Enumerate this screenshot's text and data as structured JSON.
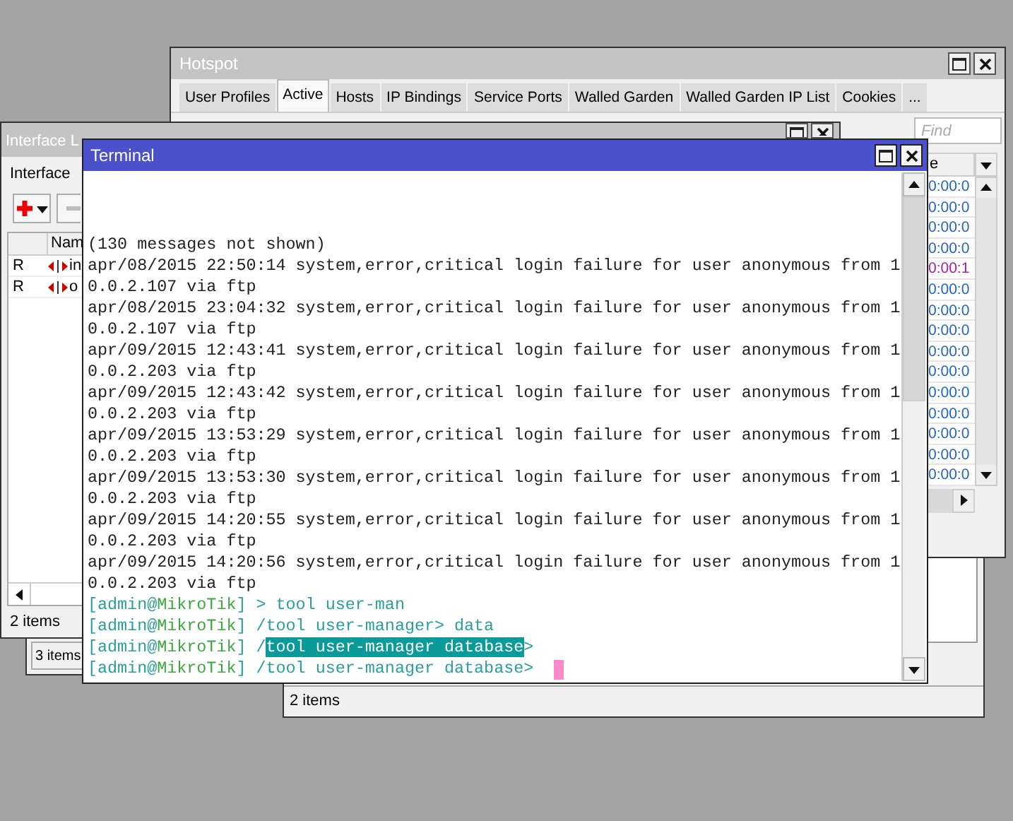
{
  "hotspot": {
    "title": "Hotspot",
    "tabs": [
      {
        "label": "User Profiles",
        "selected": false
      },
      {
        "label": "Active",
        "selected": true
      },
      {
        "label": "Hosts",
        "selected": false
      },
      {
        "label": "IP Bindings",
        "selected": false
      },
      {
        "label": "Service Ports",
        "selected": false
      },
      {
        "label": "Walled Garden",
        "selected": false
      },
      {
        "label": "Walled Garden IP List",
        "selected": false
      },
      {
        "label": "Cookies",
        "selected": false
      },
      {
        "label": "...",
        "selected": false
      }
    ],
    "search": {
      "placeholder": "Find"
    },
    "column": "e",
    "rows": [
      {
        "text": "0:00:0",
        "color": "#1f66c4"
      },
      {
        "text": "0:00:0",
        "color": "#1f66c4"
      },
      {
        "text": "0:00:0",
        "color": "#1f66c4"
      },
      {
        "text": "0:00:0",
        "color": "#1f66c4"
      },
      {
        "text": "0:00:1",
        "color": "#a01fa8"
      },
      {
        "text": "0:00:0",
        "color": "#1f66c4"
      },
      {
        "text": "0:00:0",
        "color": "#1f66c4"
      },
      {
        "text": "0:00:0",
        "color": "#1f66c4"
      },
      {
        "text": "0:00:0",
        "color": "#1f66c4"
      },
      {
        "text": "0:00:0",
        "color": "#1f66c4"
      },
      {
        "text": "0:00:0",
        "color": "#1f66c4"
      },
      {
        "text": "0:00:0",
        "color": "#1f66c4"
      },
      {
        "text": "0:00:0",
        "color": "#1f66c4"
      },
      {
        "text": "0:00:0",
        "color": "#1f66c4"
      },
      {
        "text": "0:00:0",
        "color": "#1f66c4"
      }
    ]
  },
  "back_window": {
    "status": "2 items"
  },
  "small_window": {
    "status": "3 items"
  },
  "interface_list": {
    "title": "Interface L",
    "tab": "Interface",
    "column": "Nam",
    "rows": [
      {
        "flag": "R",
        "name": "in"
      },
      {
        "flag": "R",
        "name": "o"
      }
    ],
    "status": "2 items"
  },
  "terminal": {
    "title": "Terminal",
    "lines": [
      {
        "kind": "output",
        "text": "(130 messages not shown)"
      },
      {
        "kind": "output",
        "text": "apr/08/2015 22:50:14 system,error,critical login failure for user anonymous from 1"
      },
      {
        "kind": "output",
        "text": "0.0.2.107 via ftp"
      },
      {
        "kind": "output",
        "text": "apr/08/2015 23:04:32 system,error,critical login failure for user anonymous from 1"
      },
      {
        "kind": "output",
        "text": "0.0.2.107 via ftp"
      },
      {
        "kind": "output",
        "text": "apr/09/2015 12:43:41 system,error,critical login failure for user anonymous from 1"
      },
      {
        "kind": "output",
        "text": "0.0.2.203 via ftp"
      },
      {
        "kind": "output",
        "text": "apr/09/2015 12:43:42 system,error,critical login failure for user anonymous from 1"
      },
      {
        "kind": "output",
        "text": "0.0.2.203 via ftp"
      },
      {
        "kind": "output",
        "text": "apr/09/2015 13:53:29 system,error,critical login failure for user anonymous from 1"
      },
      {
        "kind": "output",
        "text": "0.0.2.203 via ftp"
      },
      {
        "kind": "output",
        "text": "apr/09/2015 13:53:30 system,error,critical login failure for user anonymous from 1"
      },
      {
        "kind": "output",
        "text": "0.0.2.203 via ftp"
      },
      {
        "kind": "output",
        "text": "apr/09/2015 14:20:55 system,error,critical login failure for user anonymous from 1"
      },
      {
        "kind": "output",
        "text": "0.0.2.203 via ftp"
      },
      {
        "kind": "output",
        "text": "apr/09/2015 14:20:56 system,error,critical login failure for user anonymous from 1"
      },
      {
        "kind": "output",
        "text": "0.0.2.203 via ftp"
      },
      {
        "kind": "prompt",
        "user": "[admin@",
        "host": "MikroTik",
        "close": "]",
        "parts": [
          {
            "text": " > tool user-man",
            "selected": false
          }
        ],
        "cursor": false
      },
      {
        "kind": "prompt",
        "user": "[admin@",
        "host": "MikroTik",
        "close": "]",
        "parts": [
          {
            "text": " /tool user-manager> data",
            "selected": false
          }
        ],
        "cursor": false
      },
      {
        "kind": "prompt",
        "user": "[admin@",
        "host": "MikroTik",
        "close": "]",
        "parts": [
          {
            "text": " /",
            "selected": false
          },
          {
            "text": "tool user-manager database",
            "selected": true
          },
          {
            "text": ">",
            "selected": false
          }
        ],
        "cursor": false
      },
      {
        "kind": "prompt",
        "user": "[admin@",
        "host": "MikroTik",
        "close": "]",
        "parts": [
          {
            "text": " /tool user-manager database>",
            "selected": false
          }
        ],
        "cursor": true
      }
    ]
  }
}
